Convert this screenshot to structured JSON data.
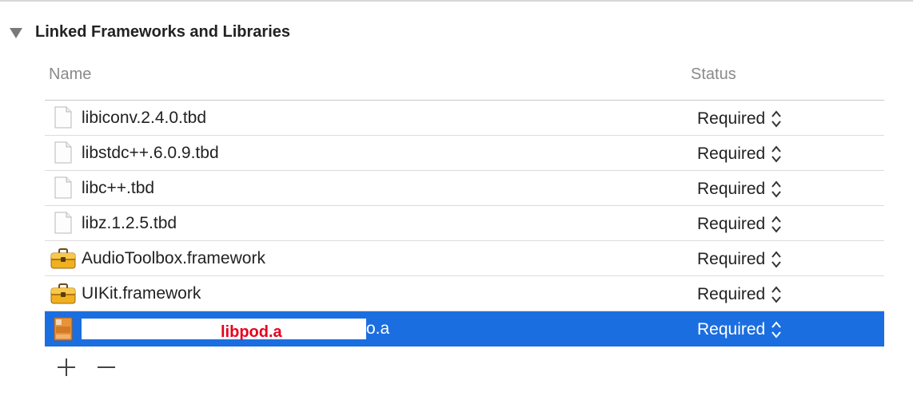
{
  "section": {
    "title": "Linked Frameworks and Libraries"
  },
  "columns": {
    "name": "Name",
    "status": "Status"
  },
  "rows": [
    {
      "name": "libiconv.2.4.0.tbd",
      "status": "Required",
      "icon": "document-icon"
    },
    {
      "name": "libstdc++.6.0.9.tbd",
      "status": "Required",
      "icon": "document-icon"
    },
    {
      "name": "libc++.tbd",
      "status": "Required",
      "icon": "document-icon"
    },
    {
      "name": "libz.1.2.5.tbd",
      "status": "Required",
      "icon": "document-icon"
    },
    {
      "name": "AudioToolbox.framework",
      "status": "Required",
      "icon": "toolbox-icon"
    },
    {
      "name": "UIKit.framework",
      "status": "Required",
      "icon": "toolbox-icon"
    }
  ],
  "selected_row": {
    "redaction_label": "libpod.a",
    "visible_suffix": "o.a",
    "status": "Required",
    "icon": "archive-icon"
  },
  "toolbar": {
    "add_label": "+",
    "remove_label": "−"
  },
  "colors": {
    "selection": "#1b6ee0",
    "redaction_text": "#e8001c"
  }
}
